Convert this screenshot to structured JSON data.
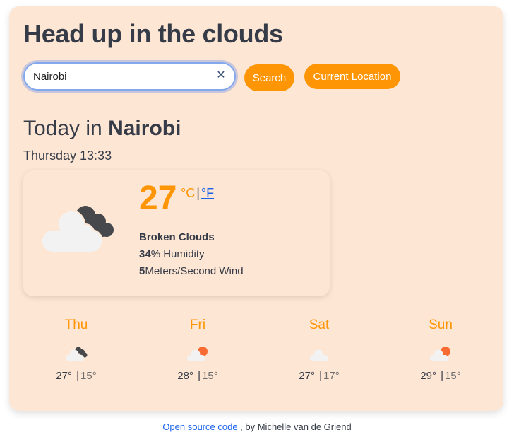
{
  "app": {
    "title": "Head up in the clouds"
  },
  "search": {
    "value": "Nairobi",
    "clear_icon": "close-icon",
    "search_label": "Search",
    "location_label": "Current Location"
  },
  "today": {
    "prefix": "Today in ",
    "city": "Nairobi",
    "datetime": "Thursday 13:33",
    "temperature": "27",
    "unit_celsius": "°C",
    "unit_separator": "|",
    "unit_fahrenheit": "°F",
    "description": "Broken Clouds",
    "humidity_value": "34",
    "humidity_label": "% Humidity",
    "wind_value": "5",
    "wind_label": "Meters/Second Wind",
    "icon": "broken-clouds-icon"
  },
  "forecast": [
    {
      "day": "Thu",
      "icon": "broken-clouds-icon",
      "max": "27°",
      "min": "15°"
    },
    {
      "day": "Fri",
      "icon": "few-clouds-day-icon",
      "max": "28°",
      "min": "15°"
    },
    {
      "day": "Sat",
      "icon": "scattered-clouds-icon",
      "max": "27°",
      "min": "17°"
    },
    {
      "day": "Sun",
      "icon": "few-clouds-day-icon",
      "max": "29°",
      "min": "15°"
    }
  ],
  "forecast_separator": "|",
  "footer": {
    "link_text": "Open source code",
    "suffix": " , by Michelle van de Griend"
  },
  "colors": {
    "accent": "#fd9505",
    "background": "#fee6d4",
    "link": "#1a62ea",
    "text": "#353b47",
    "sun": "#f86b33",
    "dark_cloud": "#47484b",
    "light_cloud": "#f2f2f2"
  }
}
